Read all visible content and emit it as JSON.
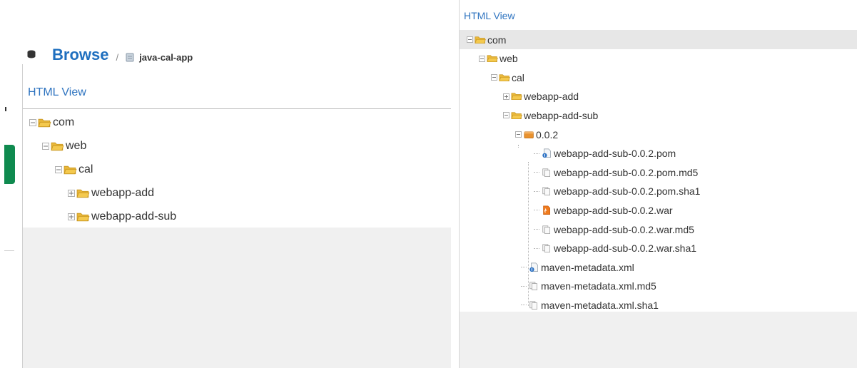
{
  "left_panel": {
    "breadcrumb": {
      "title": "Browse",
      "separator": "/",
      "repo": "java-cal-app"
    },
    "view_title": "HTML View",
    "tree": [
      {
        "label": "com",
        "type": "folder",
        "expanded": true,
        "depth": 0
      },
      {
        "label": "web",
        "type": "folder",
        "expanded": true,
        "depth": 1
      },
      {
        "label": "cal",
        "type": "folder",
        "expanded": true,
        "depth": 2
      },
      {
        "label": "webapp-add",
        "type": "folder",
        "expanded": false,
        "depth": 3
      },
      {
        "label": "webapp-add-sub",
        "type": "folder",
        "expanded": false,
        "depth": 3
      }
    ]
  },
  "right_panel": {
    "view_title": "HTML View",
    "tree": [
      {
        "label": "com",
        "type": "folder",
        "expanded": true,
        "selected": true
      },
      {
        "label": "web",
        "type": "folder",
        "expanded": true
      },
      {
        "label": "cal",
        "type": "folder",
        "expanded": true
      },
      {
        "label": "webapp-add",
        "type": "folder",
        "expanded": false
      },
      {
        "label": "webapp-add-sub",
        "type": "folder",
        "expanded": true
      },
      {
        "label": "0.0.2",
        "type": "version",
        "expanded": true
      },
      {
        "label": "webapp-add-sub-0.0.2.pom",
        "type": "pom"
      },
      {
        "label": "webapp-add-sub-0.0.2.pom.md5",
        "type": "checksum"
      },
      {
        "label": "webapp-add-sub-0.0.2.pom.sha1",
        "type": "checksum"
      },
      {
        "label": "webapp-add-sub-0.0.2.war",
        "type": "war"
      },
      {
        "label": "webapp-add-sub-0.0.2.war.md5",
        "type": "checksum"
      },
      {
        "label": "webapp-add-sub-0.0.2.war.sha1",
        "type": "checksum"
      },
      {
        "label": "maven-metadata.xml",
        "type": "pom"
      },
      {
        "label": "maven-metadata.xml.md5",
        "type": "checksum"
      },
      {
        "label": "maven-metadata.xml.sha1",
        "type": "checksum"
      }
    ]
  },
  "icons": {
    "folder": "folder-open-icon",
    "version": "package-icon",
    "pom": "xml-file-icon",
    "war": "war-file-icon",
    "checksum": "file-copy-icon",
    "expanded": "tree-minus-icon",
    "collapsed": "tree-plus-icon",
    "breadcrumb_db": "database-icon",
    "breadcrumb_repo": "repository-icon"
  },
  "colors": {
    "link_blue": "#2f74c0",
    "title_blue": "#1f6fbf",
    "folder_yellow": "#f4c94e",
    "package_orange": "#e8912e",
    "war_orange": "#f07b1d",
    "accent_green": "#0f8a4f",
    "selected_row": "#e7e7e7"
  }
}
